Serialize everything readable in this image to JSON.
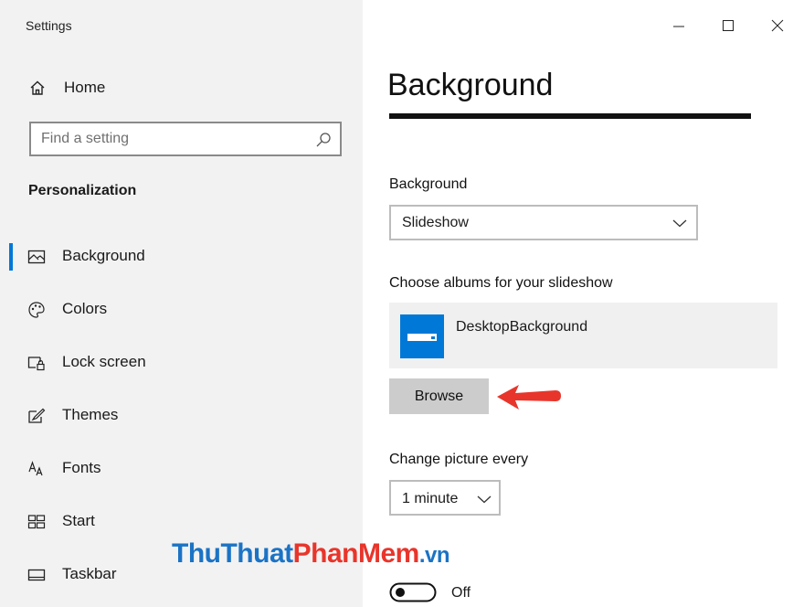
{
  "window": {
    "title": "Settings"
  },
  "sidebar": {
    "home_label": "Home",
    "search_placeholder": "Find a setting",
    "section_title": "Personalization",
    "items": [
      {
        "label": "Background",
        "icon": "image-icon",
        "active": true
      },
      {
        "label": "Colors",
        "icon": "palette-icon",
        "active": false
      },
      {
        "label": "Lock screen",
        "icon": "lock-screen-icon",
        "active": false
      },
      {
        "label": "Themes",
        "icon": "themes-icon",
        "active": false
      },
      {
        "label": "Fonts",
        "icon": "fonts-icon",
        "active": false
      },
      {
        "label": "Start",
        "icon": "start-icon",
        "active": false
      },
      {
        "label": "Taskbar",
        "icon": "taskbar-icon",
        "active": false
      }
    ]
  },
  "main": {
    "page_title": "Background",
    "background_label": "Background",
    "background_value": "Slideshow",
    "albums_label": "Choose albums for your slideshow",
    "album_name": "DesktopBackground",
    "browse_label": "Browse",
    "change_label": "Change picture every",
    "change_value": "1 minute",
    "toggle_state": "Off"
  },
  "watermark": {
    "part1": "ThuThuat",
    "part2": "PhanMem",
    "part3": ".vn"
  },
  "colors": {
    "accent": "#0078d7",
    "sidebar_bg": "#f2f2f2",
    "arrow": "#e8352b"
  }
}
